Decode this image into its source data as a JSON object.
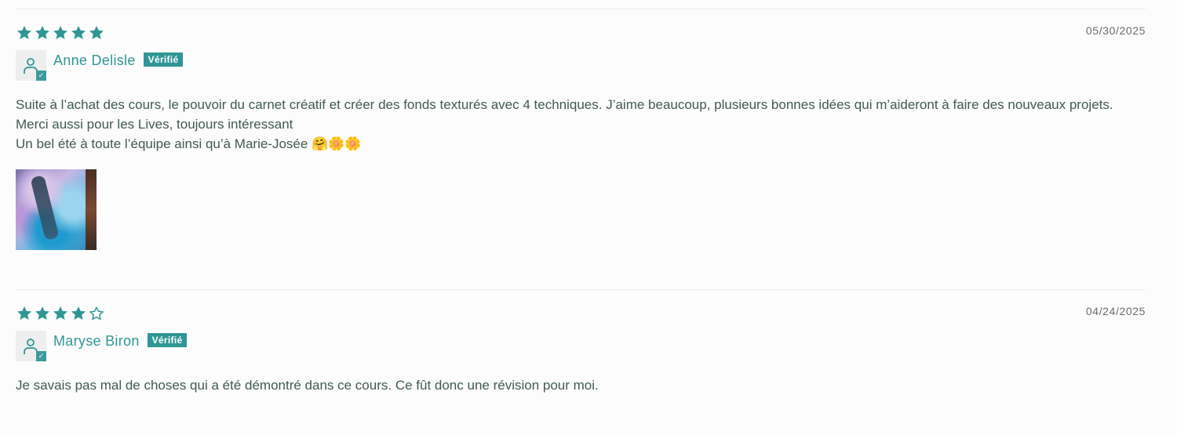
{
  "reviews": [
    {
      "rating": 5,
      "date": "05/30/2025",
      "author": "Anne Delisle",
      "badge": "Vérifié",
      "body": [
        "Suite à l’achat des cours, le pouvoir du carnet créatif et créer des fonds texturés avec 4 techniques. J’aime beaucoup, plusieurs bonnes idées qui m’aideront à faire des nouveaux projets.",
        "Merci aussi pour les Lives, toujours intéressant",
        "Un bel été à toute l’équipe ainsi qu’à Marie-Josée 🤗🌼🌼"
      ],
      "has_photo": true
    },
    {
      "rating": 4,
      "date": "04/24/2025",
      "author": "Maryse Biron",
      "badge": "Vérifié",
      "body": [
        "Je savais pas mal de choses qui a été démontré dans ce cours. Ce fût donc une révision pour moi."
      ],
      "has_photo": false
    }
  ],
  "icons": {
    "star_filled": "star-filled-icon",
    "star_empty": "star-outline-icon",
    "avatar": "user-icon",
    "verified": "check-icon"
  },
  "colors": {
    "accent": "#2f9695",
    "text": "#3f5a4f",
    "date": "#6b6b6b",
    "divider": "#e9ecea"
  }
}
